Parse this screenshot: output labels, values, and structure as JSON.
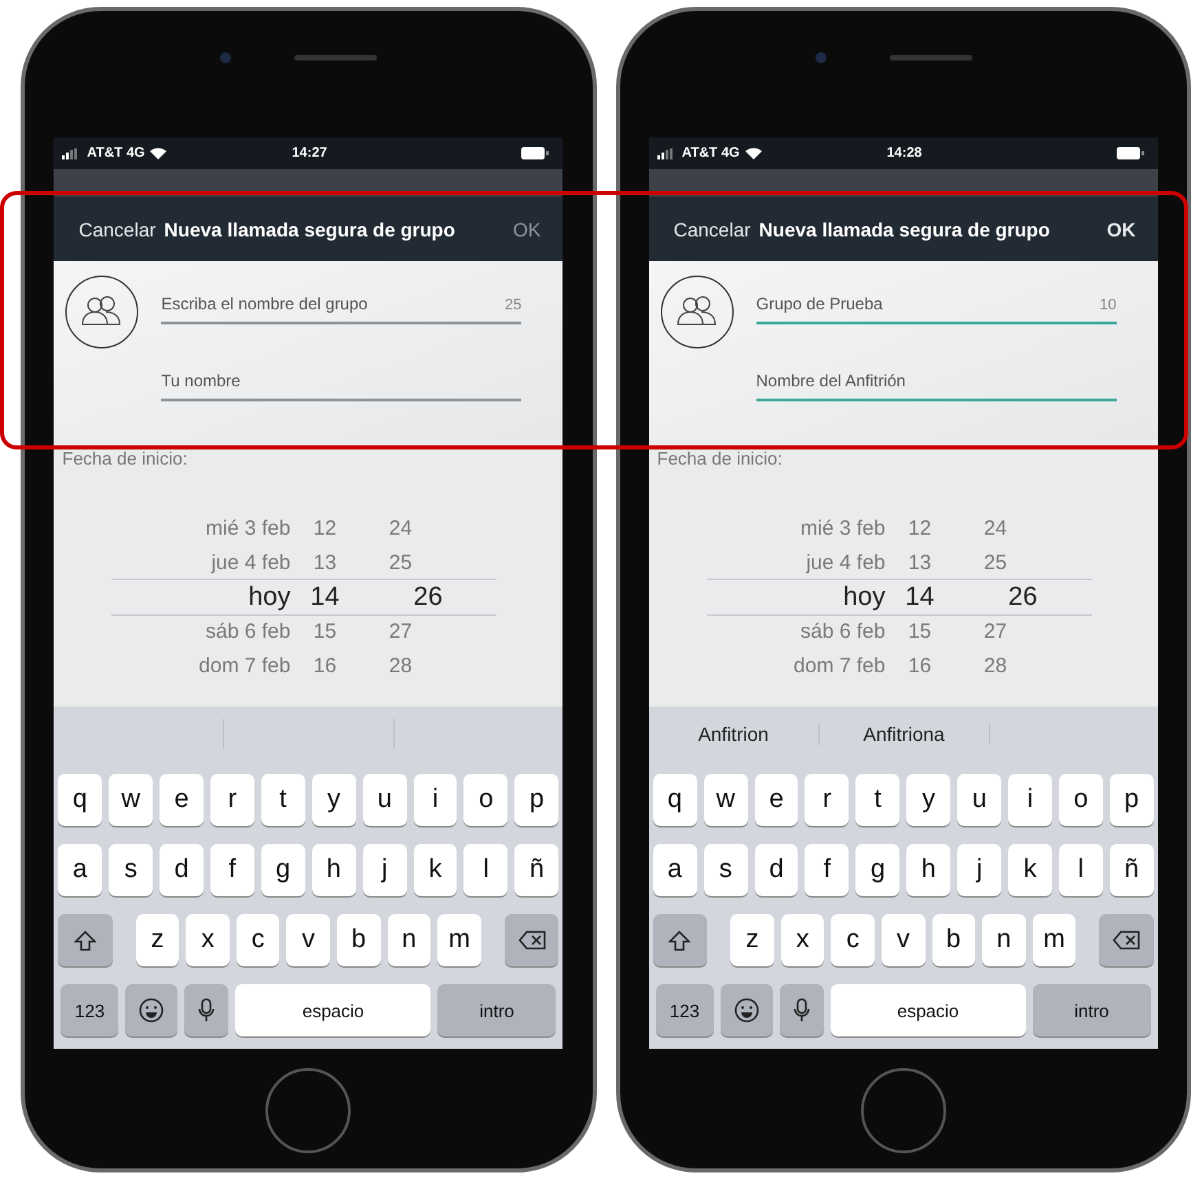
{
  "phones": [
    {
      "status": {
        "carrier": "AT&T 4G",
        "time": "14:27"
      },
      "nav": {
        "cancel": "Cancelar",
        "title": "Nueva llamada segura de grupo",
        "ok": "OK",
        "ok_enabled": false
      },
      "fields": [
        {
          "placeholder": "Escriba el nombre del grupo",
          "counter": "25",
          "filled": false
        },
        {
          "placeholder": "Tu nombre",
          "filled": false
        }
      ],
      "date_label": "Fecha de inicio:",
      "picker": [
        {
          "day": "mié 3 feb",
          "hour": "12",
          "minute": "24",
          "selected": false
        },
        {
          "day": "jue 4 feb",
          "hour": "13",
          "minute": "25",
          "selected": false
        },
        {
          "day": "hoy",
          "hour": "14",
          "minute": "26",
          "selected": true
        },
        {
          "day": "sáb 6 feb",
          "hour": "15",
          "minute": "27",
          "selected": false
        },
        {
          "day": "dom 7 feb",
          "hour": "16",
          "minute": "28",
          "selected": false
        }
      ],
      "keyboard": {
        "rows": [
          [
            "q",
            "w",
            "e",
            "r",
            "t",
            "y",
            "u",
            "i",
            "o",
            "p"
          ],
          [
            "a",
            "s",
            "d",
            "f",
            "g",
            "h",
            "j",
            "k",
            "l",
            "ñ"
          ],
          [
            "z",
            "x",
            "c",
            "v",
            "b",
            "n",
            "m"
          ]
        ],
        "numbers": "123",
        "space": "espacio",
        "return": "intro"
      }
    },
    {
      "status": {
        "carrier": "AT&T 4G",
        "time": "14:28"
      },
      "nav": {
        "cancel": "Cancelar",
        "title": "Nueva llamada segura de grupo",
        "ok": "OK",
        "ok_enabled": true
      },
      "fields": [
        {
          "value": "Grupo de Prueba",
          "counter": "10",
          "filled": true
        },
        {
          "value": "Nombre del Anfitrión",
          "filled": true
        }
      ],
      "date_label": "Fecha de inicio:",
      "picker": [
        {
          "day": "mié 3 feb",
          "hour": "12",
          "minute": "24",
          "selected": false
        },
        {
          "day": "jue 4 feb",
          "hour": "13",
          "minute": "25",
          "selected": false
        },
        {
          "day": "hoy",
          "hour": "14",
          "minute": "26",
          "selected": true
        },
        {
          "day": "sáb 6 feb",
          "hour": "15",
          "minute": "27",
          "selected": false
        },
        {
          "day": "dom 7 feb",
          "hour": "16",
          "minute": "28",
          "selected": false
        }
      ],
      "suggestions": [
        "Anfitrion",
        "Anfitriona"
      ],
      "keyboard": {
        "rows": [
          [
            "q",
            "w",
            "e",
            "r",
            "t",
            "y",
            "u",
            "i",
            "o",
            "p"
          ],
          [
            "a",
            "s",
            "d",
            "f",
            "g",
            "h",
            "j",
            "k",
            "l",
            "ñ"
          ],
          [
            "z",
            "x",
            "c",
            "v",
            "b",
            "n",
            "m"
          ]
        ],
        "numbers": "123",
        "space": "espacio",
        "return": "intro"
      }
    }
  ],
  "highlight": {
    "shown": true
  }
}
